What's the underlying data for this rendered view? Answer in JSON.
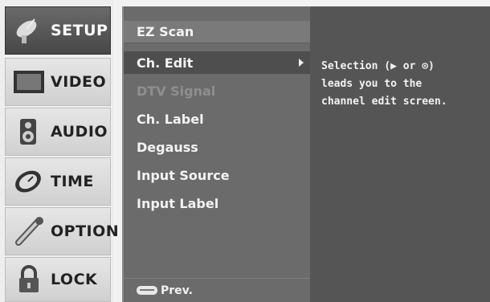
{
  "sidebar": {
    "items": [
      {
        "label": "SETUP",
        "icon": "satellite-dish-icon",
        "active": true
      },
      {
        "label": "VIDEO",
        "icon": "monitor-icon",
        "active": false
      },
      {
        "label": "AUDIO",
        "icon": "speaker-icon",
        "active": false
      },
      {
        "label": "TIME",
        "icon": "clock-icon",
        "active": false
      },
      {
        "label": "OPTION",
        "icon": "wrench-icon",
        "active": false
      },
      {
        "label": "LOCK",
        "icon": "padlock-icon",
        "active": false
      }
    ]
  },
  "menu": {
    "items": [
      {
        "label": "EZ Scan"
      },
      {
        "label": "Ch. Edit",
        "selected": true
      },
      {
        "label": "DTV Signal",
        "disabled": true
      },
      {
        "label": "Ch. Label"
      },
      {
        "label": "Degauss"
      },
      {
        "label": "Input Source"
      },
      {
        "label": "Input Label"
      }
    ],
    "prev_label": "Prev."
  },
  "help": {
    "lines": [
      "Selection (▶ or ⊙)",
      "leads you to the",
      "channel edit screen."
    ]
  },
  "colors": {
    "active_category": "#505050",
    "menu_bg": "#6b6b6b",
    "selected_item": "#4e4e4e",
    "help_bg": "#555555"
  }
}
